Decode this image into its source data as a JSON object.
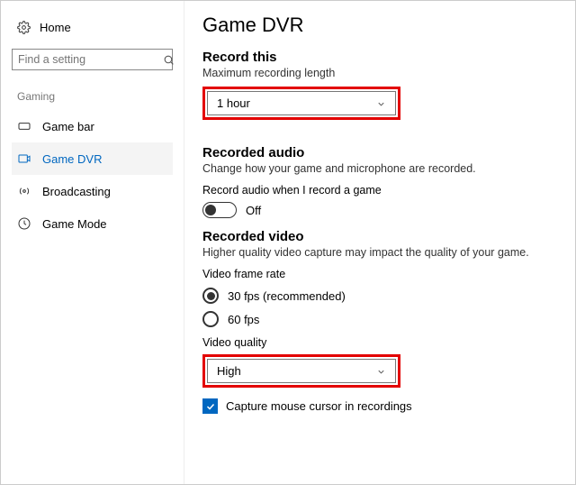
{
  "sidebar": {
    "home_label": "Home",
    "search_placeholder": "Find a setting",
    "section_label": "Gaming",
    "items": [
      {
        "label": "Game bar"
      },
      {
        "label": "Game DVR"
      },
      {
        "label": "Broadcasting"
      },
      {
        "label": "Game Mode"
      }
    ]
  },
  "main": {
    "title": "Game DVR",
    "record_this": {
      "heading": "Record this",
      "label": "Maximum recording length",
      "value": "1 hour"
    },
    "recorded_audio": {
      "heading": "Recorded audio",
      "desc": "Change how your game and microphone are recorded.",
      "toggle_label": "Record audio when I record a game",
      "toggle_state": "Off"
    },
    "recorded_video": {
      "heading": "Recorded video",
      "desc": "Higher quality video capture may impact the quality of your game.",
      "framerate_label": "Video frame rate",
      "framerate_options": {
        "a": "30 fps (recommended)",
        "b": "60 fps"
      },
      "quality_label": "Video quality",
      "quality_value": "High"
    },
    "capture_cursor_label": "Capture mouse cursor in recordings"
  },
  "colors": {
    "accent": "#0067c0",
    "highlight": "#e30000"
  }
}
